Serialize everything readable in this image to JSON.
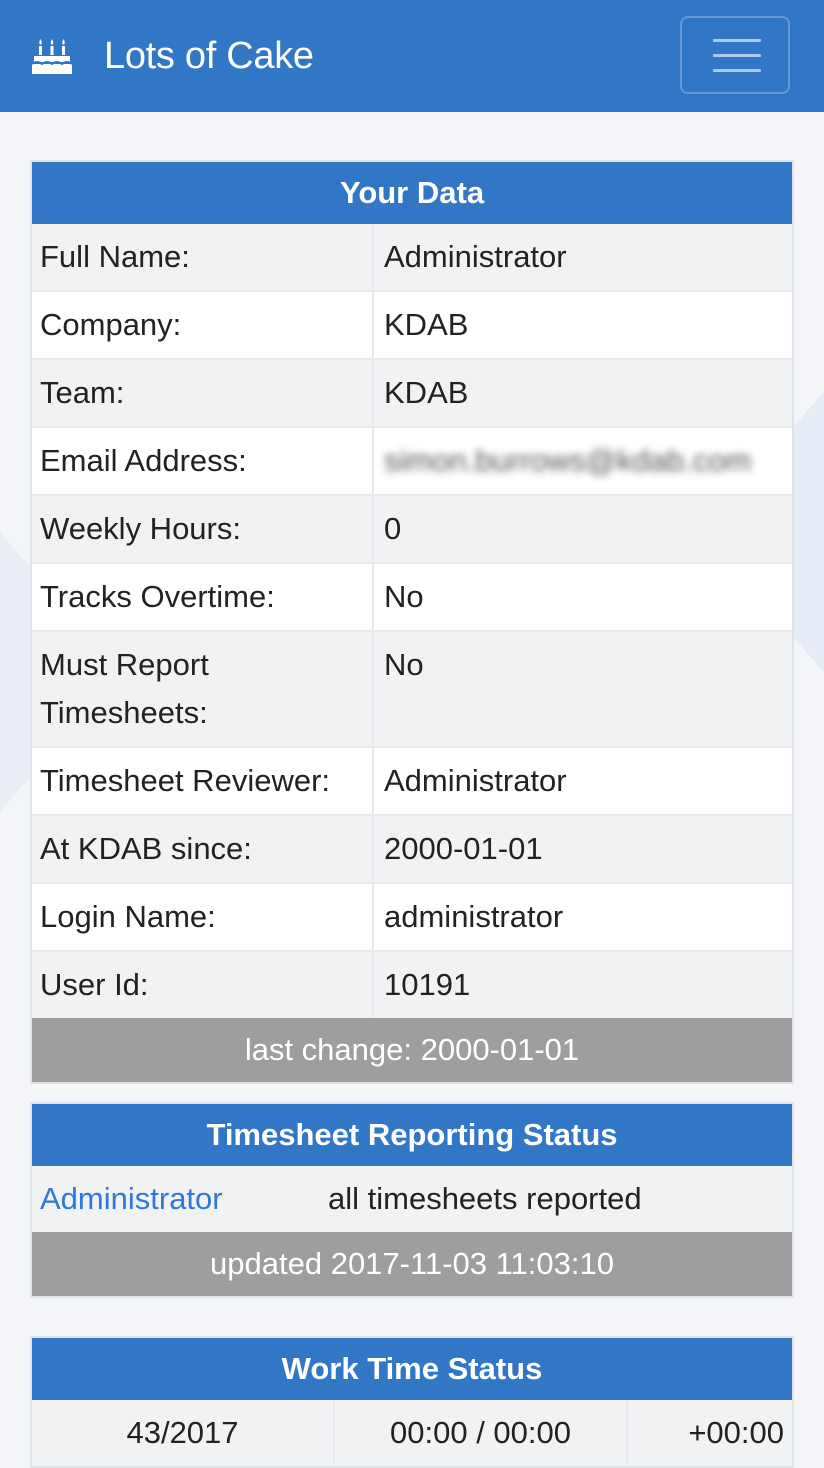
{
  "navbar": {
    "brand_name": "Lots of Cake",
    "brand_icon": "birthday-cake-icon",
    "toggle_icon": "hamburger-menu-icon"
  },
  "your_data": {
    "title": "Your Data",
    "rows": [
      {
        "label": "Full Name:",
        "value": "Administrator"
      },
      {
        "label": "Company:",
        "value": "KDAB"
      },
      {
        "label": "Team:",
        "value": "KDAB"
      },
      {
        "label": "Email Address:",
        "value": "simon.burrows@kdab.com"
      },
      {
        "label": "Weekly Hours:",
        "value": "0"
      },
      {
        "label": "Tracks Overtime:",
        "value": "No"
      },
      {
        "label": "Must Report Timesheets:",
        "value": "No"
      },
      {
        "label": "Timesheet Reviewer:",
        "value": "Administrator"
      },
      {
        "label": "At KDAB since:",
        "value": "2000-01-01"
      },
      {
        "label": "Login Name:",
        "value": "administrator"
      },
      {
        "label": "User Id:",
        "value": "10191"
      }
    ],
    "footer": "last change: 2000-01-01"
  },
  "timesheet_status": {
    "title": "Timesheet Reporting Status",
    "user_link": "Administrator",
    "status": "all timesheets reported",
    "footer": "updated 2017-11-03 11:03:10"
  },
  "work_time": {
    "title": "Work Time Status",
    "rows": [
      {
        "week": "43/2017",
        "time": "00:00 / 00:00",
        "balance": "+00:00"
      }
    ]
  },
  "colors": {
    "primary": "#3277c6",
    "footer_gray": "#9e9e9e",
    "link": "#2f7ad6"
  }
}
